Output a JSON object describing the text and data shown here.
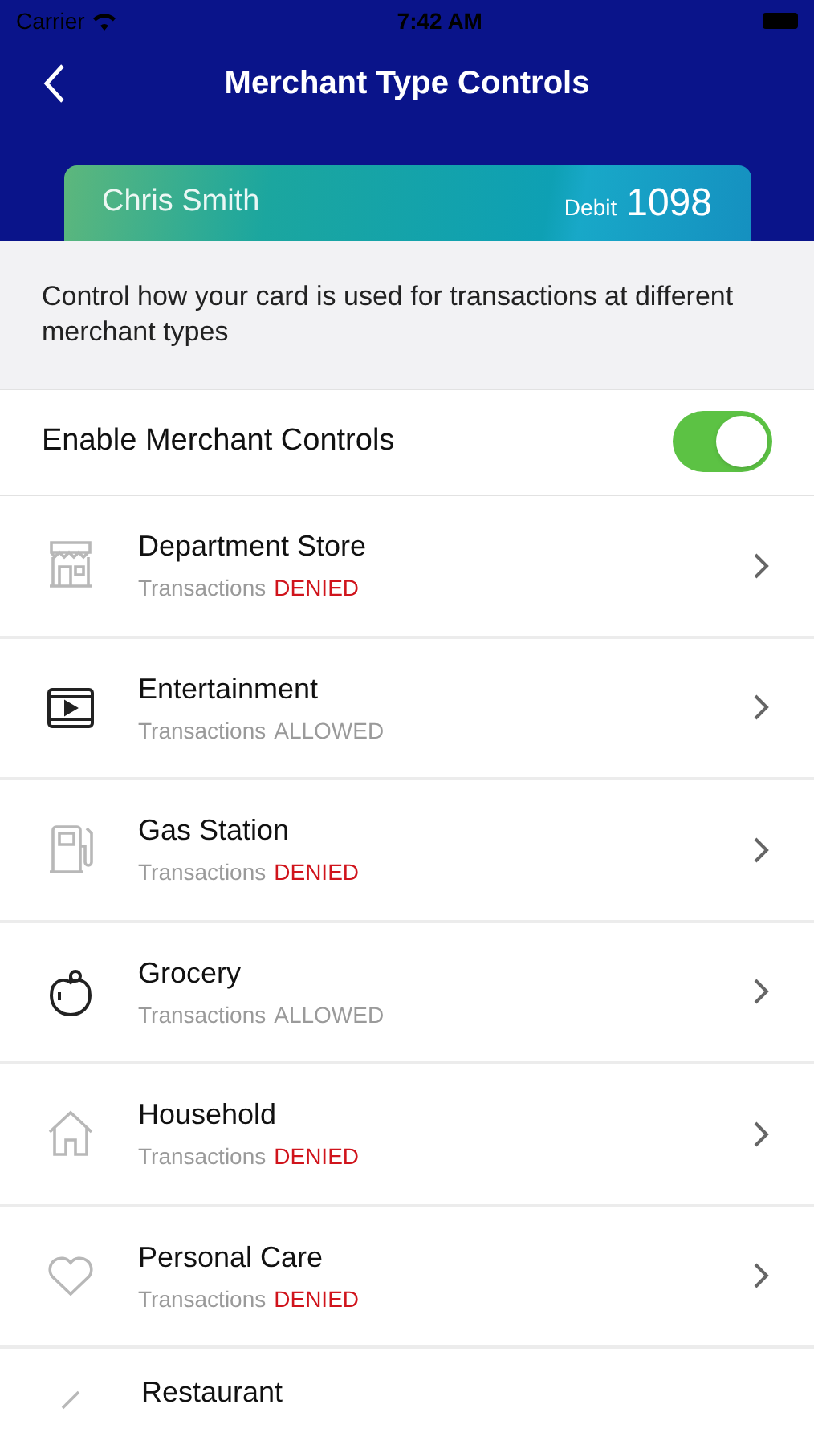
{
  "status_bar": {
    "carrier": "Carrier",
    "time": "7:42 AM"
  },
  "header": {
    "title": "Merchant Type Controls"
  },
  "card": {
    "name": "Chris Smith",
    "type": "Debit",
    "number": "1098"
  },
  "description": "Control how your card is used for transactions at different merchant types",
  "master_toggle": {
    "label": "Enable Merchant Controls",
    "on": true
  },
  "merchants": [
    {
      "name": "Department Store",
      "prefix": "Transactions",
      "status": "DENIED",
      "denied": true
    },
    {
      "name": "Entertainment",
      "prefix": "Transactions",
      "status": "ALLOWED",
      "denied": false
    },
    {
      "name": "Gas Station",
      "prefix": "Transactions",
      "status": "DENIED",
      "denied": true
    },
    {
      "name": "Grocery",
      "prefix": "Transactions",
      "status": "ALLOWED",
      "denied": false
    },
    {
      "name": "Household",
      "prefix": "Transactions",
      "status": "DENIED",
      "denied": true
    },
    {
      "name": "Personal Care",
      "prefix": "Transactions",
      "status": "DENIED",
      "denied": true
    },
    {
      "name": "Restaurant"
    }
  ]
}
